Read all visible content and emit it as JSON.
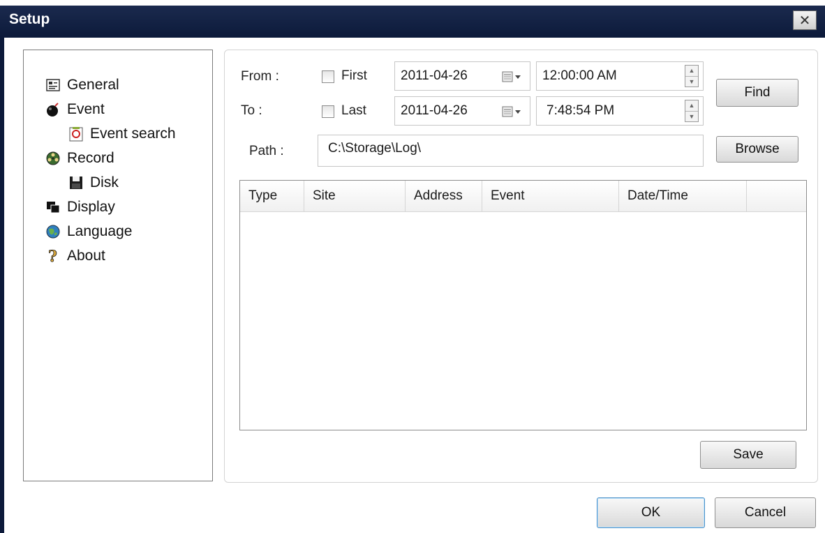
{
  "window": {
    "title": "Setup",
    "close_glyph": "✕"
  },
  "tree": {
    "items": [
      {
        "label": "General",
        "icon": "general-icon"
      },
      {
        "label": "Event",
        "icon": "bomb-icon"
      },
      {
        "label": "Event search",
        "icon": "event-search-icon"
      },
      {
        "label": "Record",
        "icon": "film-reel-icon"
      },
      {
        "label": "Disk",
        "icon": "floppy-disk-icon"
      },
      {
        "label": "Display",
        "icon": "display-icon"
      },
      {
        "label": "Language",
        "icon": "globe-icon"
      },
      {
        "label": "About",
        "icon": "question-icon"
      }
    ]
  },
  "search": {
    "from_label": "From :",
    "to_label": "To :",
    "first_label": "First",
    "last_label": "Last",
    "from_date": "2011-04-26",
    "to_date": "2011-04-26",
    "from_time": "12:00:00 AM",
    "to_time": "7:48:54 PM",
    "path_label": "Path :",
    "path_value": "C:\\Storage\\Log\\",
    "find_label": "Find",
    "browse_label": "Browse"
  },
  "table": {
    "columns": [
      "Type",
      "Site",
      "Address",
      "Event",
      "Date/Time"
    ]
  },
  "footer": {
    "save_label": "Save",
    "ok_label": "OK",
    "cancel_label": "Cancel"
  }
}
